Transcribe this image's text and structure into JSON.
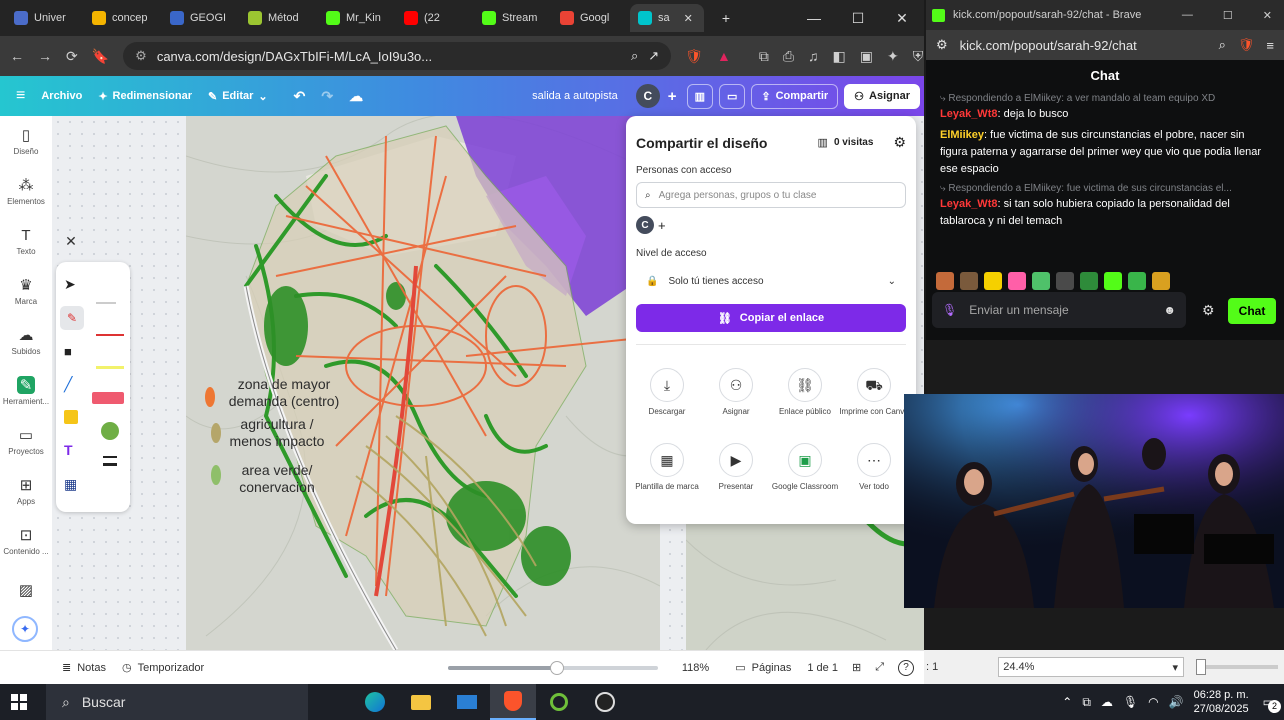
{
  "browser": {
    "tabs": [
      {
        "label": "Univer",
        "icon": "university-icon",
        "color": "#4b6cc9"
      },
      {
        "label": "concep",
        "icon": "drive-icon",
        "color": "#f4b400"
      },
      {
        "label": "GEOGI",
        "icon": "docs-icon",
        "color": "#3a67c9"
      },
      {
        "label": "Métod",
        "icon": "doc-icon",
        "color": "#9bc531"
      },
      {
        "label": "Mr_Kin",
        "icon": "kick-icon",
        "color": "#53fc18"
      },
      {
        "label": "(22",
        "icon": "youtube-icon",
        "color": "#ff0000"
      },
      {
        "label": "Stream",
        "icon": "kick-icon",
        "color": "#53fc18"
      },
      {
        "label": "Googl",
        "icon": "maps-icon",
        "color": "#ea4335"
      },
      {
        "label": "sa",
        "icon": "canva-icon",
        "color": "#00c4cc"
      }
    ],
    "url": "canva.com/design/DAGxTbIFi-M/LcA_IoI9u3o..."
  },
  "canva": {
    "menu": {
      "archivo": "Archivo",
      "redimensionar": "Redimensionar",
      "editar": "Editar",
      "title": "salida a autopista",
      "avatar": "C",
      "compartir": "Compartir",
      "asignar": "Asignar"
    },
    "rail": [
      {
        "label": "Diseño",
        "icon": "layout-icon"
      },
      {
        "label": "Elementos",
        "icon": "elements-icon"
      },
      {
        "label": "Texto",
        "icon": "text-icon"
      },
      {
        "label": "Marca",
        "icon": "brand-icon"
      },
      {
        "label": "Subidos",
        "icon": "upload-icon"
      },
      {
        "label": "Herramient...",
        "icon": "tools-icon"
      },
      {
        "label": "Proyectos",
        "icon": "folder-icon"
      },
      {
        "label": "Apps",
        "icon": "apps-icon"
      },
      {
        "label": "Contenido ...",
        "icon": "content-icon"
      },
      {
        "label": "",
        "icon": "image-icon"
      }
    ],
    "legend": {
      "item1": "zona de mayor demanda (centro)",
      "item2": "agricultura / menos impacto",
      "item3": "area verde/ conervacion"
    },
    "share": {
      "title": "Compartir el diseño",
      "visits": "0 visitas",
      "people_label": "Personas con acceso",
      "search_placeholder": "Agrega personas, grupos o tu clase",
      "avatar": "C",
      "access_label": "Nivel de acceso",
      "access_value": "Solo tú tienes acceso",
      "copy_button": "Copiar el enlace",
      "options": [
        {
          "label": "Descargar",
          "icon": "download-icon"
        },
        {
          "label": "Asignar",
          "icon": "assign-icon"
        },
        {
          "label": "Enlace público",
          "icon": "link-icon"
        },
        {
          "label": "Imprime con Canva",
          "icon": "truck-icon"
        },
        {
          "label": "Plantilla de marca",
          "icon": "template-icon"
        },
        {
          "label": "Presentar",
          "icon": "present-icon"
        },
        {
          "label": "Google Classroom",
          "icon": "classroom-icon"
        },
        {
          "label": "Ver todo",
          "icon": "more-icon"
        }
      ]
    },
    "bottom": {
      "notas": "Notas",
      "temporizador": "Temporizador",
      "zoom": "118%",
      "zoom_fraction": 0.52,
      "paginas": "Páginas",
      "page_count": "1 de 1"
    }
  },
  "chat": {
    "window_url_title": "kick.com/popout/sarah-92/chat - Brave",
    "url": "kick.com/popout/sarah-92/chat",
    "header": "Chat",
    "messages": [
      {
        "reply": "Respondiendo a ElMiikey: a ver mandalo al team equipo XD",
        "user": "Leyak_Wt8",
        "user_color": "#ff3838",
        "text": ": deja lo busco"
      },
      {
        "reply": "",
        "user": "ElMiikey",
        "user_color": "#ffd12a",
        "text": ": fue victima de sus circunstancias el pobre, nacer sin figura paterna y agarrarse del primer wey que vio que podia llenar ese espacio"
      },
      {
        "reply": "Respondiendo a ElMiikey: fue victima de sus circunstancias el...",
        "user": "Leyak_Wt8",
        "user_color": "#ff3838",
        "text": ": si tan solo hubiera copiado la personalidad del tablaroca y ni del temach"
      }
    ],
    "input_placeholder": "Enviar un mensaje",
    "send_button": "Chat"
  },
  "viewer": {
    "page_suffix": ": 1",
    "zoom": "24.4%"
  },
  "taskbar": {
    "search": "Buscar",
    "time": "06:28 p. m.",
    "date": "27/08/2025",
    "notifications": "2"
  }
}
